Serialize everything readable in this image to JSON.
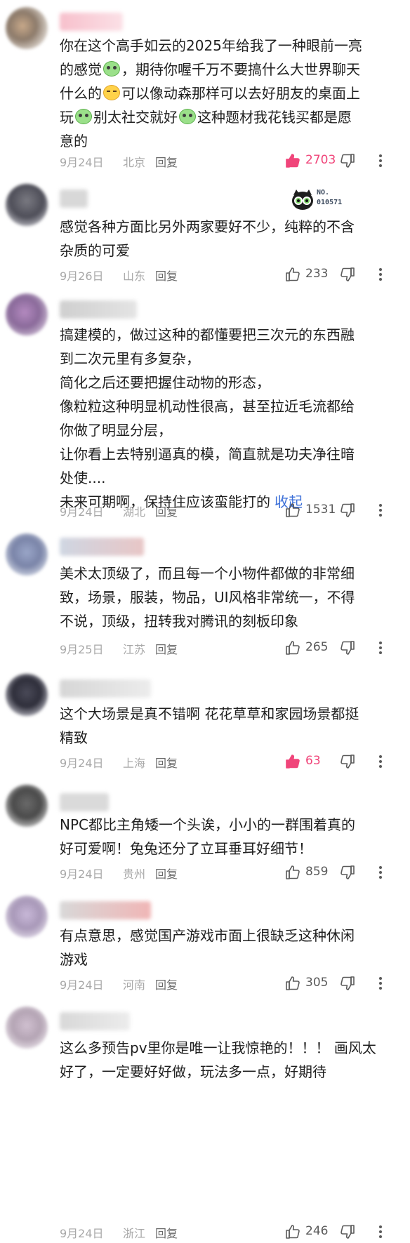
{
  "comments": [
    {
      "lines": [
        [
          {
            "t": "你在这个高手如云的2025年给我了一种眼前一亮"
          }
        ],
        [
          {
            "t": "的感觉"
          },
          {
            "emoji": "smile"
          },
          {
            "t": "，期待你喔千万不要搞什么大世界聊天"
          }
        ],
        [
          {
            "t": "什么的"
          },
          {
            "emoji": "cry"
          },
          {
            "t": "可以像动森那样可以去好朋友的桌面上"
          }
        ],
        [
          {
            "t": "玩"
          },
          {
            "emoji": "smile"
          },
          {
            "t": "别太社交就好"
          },
          {
            "emoji": "smile"
          },
          {
            "t": "这种题材我花钱买都是愿"
          }
        ],
        [
          {
            "t": "意的"
          }
        ]
      ],
      "date": "9月24日",
      "region": "北京",
      "reply": "回复",
      "likes": "2703",
      "liked": true
    },
    {
      "lines": [
        [
          {
            "t": "感觉各种方面比另外两家要好不少，纯粹的不含"
          }
        ],
        [
          {
            "t": "杂质的可爱"
          }
        ]
      ],
      "date": "9月26日",
      "region": "山东",
      "reply": "回复",
      "likes": "233",
      "liked": false
    },
    {
      "lines": [
        [
          {
            "t": "搞建模的，做过这种的都懂要把三次元的东西融"
          }
        ],
        [
          {
            "t": "到二次元里有多复杂，"
          }
        ],
        [
          {
            "t": "简化之后还要把握住动物的形态，"
          }
        ],
        [
          {
            "t": "像粒粒这种明显机动性很高，甚至拉近毛流都给"
          }
        ],
        [
          {
            "t": "你做了明显分层，"
          }
        ],
        [
          {
            "t": "让你看上去特别逼真的模，简直就是功夫净往暗"
          }
        ],
        [
          {
            "t": "处使...."
          }
        ],
        [
          {
            "t": "未来可期啊，保持住应该蛮能打的"
          },
          {
            "link": "收起"
          }
        ]
      ],
      "date": "9月24日",
      "region": "湖北",
      "reply": "回复",
      "likes": "1531",
      "liked": false
    },
    {
      "lines": [
        [
          {
            "t": "美术太顶级了，而且每一个小物件都做的非常细"
          }
        ],
        [
          {
            "t": "致，场景，服装，物品，UI风格非常统一，不得"
          }
        ],
        [
          {
            "t": "不说，顶级，扭转我对腾讯的刻板印象"
          }
        ]
      ],
      "date": "9月25日",
      "region": "江苏",
      "reply": "回复",
      "likes": "265",
      "liked": false
    },
    {
      "lines": [
        [
          {
            "t": "这个大场景是真不错啊 花花草草和家园场景都挺"
          }
        ],
        [
          {
            "t": "精致"
          }
        ]
      ],
      "date": "9月24日",
      "region": "上海",
      "reply": "回复",
      "likes": "63",
      "liked": true
    },
    {
      "lines": [
        [
          {
            "t": "NPC都比主角矮一个头诶，小小的一群围着真的"
          }
        ],
        [
          {
            "t": "好可爱啊！兔兔还分了立耳垂耳好细节！"
          }
        ]
      ],
      "date": "9月24日",
      "region": "贵州",
      "reply": "回复",
      "likes": "859",
      "liked": false
    },
    {
      "lines": [
        [
          {
            "t": "有点意思，感觉国产游戏市面上很缺乏这种休闲"
          }
        ],
        [
          {
            "t": "游戏"
          }
        ]
      ],
      "date": "9月24日",
      "region": "河南",
      "reply": "回复",
      "likes": "305",
      "liked": false
    },
    {
      "lines": [
        [
          {
            "t": "这么多预告pv里你是唯一让我惊艳的！！！ 画风太"
          }
        ],
        [
          {
            "t": "好了，一定要好好做，玩法多一点，好期待"
          }
        ]
      ],
      "date": "9月24日",
      "region": "浙江",
      "reply": "回复",
      "likes": "246",
      "liked": false
    }
  ],
  "badge": {
    "line1": "NO.",
    "line2": "010571"
  },
  "colors": {
    "liked": "#f0457a",
    "link": "#3b6fd8",
    "meta": "#a8a8a8"
  }
}
